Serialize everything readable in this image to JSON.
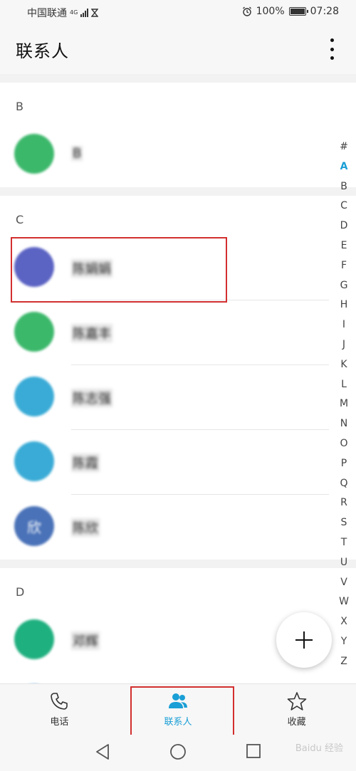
{
  "status_bar": {
    "carrier": "中国联通",
    "network_tag": "4G",
    "battery_percent": "100%",
    "time": "07:28"
  },
  "header": {
    "title": "联系人"
  },
  "sections": [
    {
      "letter": "B",
      "contacts": [
        {
          "name": "B",
          "avatar_initial": "",
          "avatar_color": "#3cb86b"
        }
      ]
    },
    {
      "letter": "C",
      "contacts": [
        {
          "name": "陈娟娟",
          "avatar_initial": "",
          "avatar_color": "#5b63c3"
        },
        {
          "name": "陈嘉丰",
          "avatar_initial": "",
          "avatar_color": "#3cb86b"
        },
        {
          "name": "陈志强",
          "avatar_initial": "",
          "avatar_color": "#3aabd6"
        },
        {
          "name": "陈霞",
          "avatar_initial": "",
          "avatar_color": "#3aabd6"
        },
        {
          "name": "陈欣",
          "avatar_initial": "欣",
          "avatar_color": "#4a72b8"
        }
      ]
    },
    {
      "letter": "D",
      "contacts": [
        {
          "name": "邓辉",
          "avatar_initial": "",
          "avatar_color": "#1fb07f"
        },
        {
          "name": "",
          "avatar_initial": "",
          "avatar_color": "#2f9ae3"
        }
      ]
    }
  ],
  "alpha_index": [
    "#",
    "A",
    "B",
    "C",
    "D",
    "E",
    "F",
    "G",
    "H",
    "I",
    "J",
    "K",
    "L",
    "M",
    "N",
    "O",
    "P",
    "Q",
    "R",
    "S",
    "T",
    "U",
    "V",
    "W",
    "X",
    "Y",
    "Z"
  ],
  "alpha_active": "A",
  "bottom_nav": {
    "tabs": [
      {
        "label": "电话",
        "icon": "phone-icon"
      },
      {
        "label": "联系人",
        "icon": "contacts-icon"
      },
      {
        "label": "收藏",
        "icon": "star-icon"
      }
    ],
    "active_index": 1
  },
  "colors": {
    "accent": "#1a9fd6",
    "highlight_box": "#d32f2f"
  },
  "watermark": "Baidu 经验"
}
